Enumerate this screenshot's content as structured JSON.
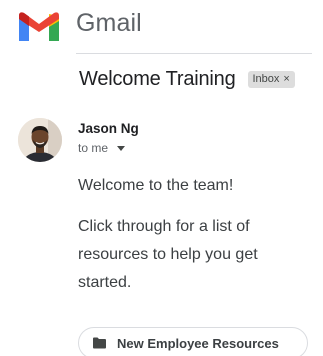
{
  "app": {
    "brand": "Gmail"
  },
  "message": {
    "subject": "Welcome Training",
    "label": {
      "name": "Inbox",
      "remove": "×"
    },
    "sender": {
      "name": "Jason Ng"
    },
    "recipient": "to me",
    "body": {
      "greeting": "Welcome to the team!",
      "paragraph": "Click through for a list of resources to help you get started."
    },
    "attachment": {
      "label": "New Employee Resources",
      "icon": "folder-icon"
    }
  },
  "colors": {
    "gmail_red": "#ea4335",
    "gmail_blue": "#4285f4",
    "gmail_green": "#34a853",
    "gmail_yellow": "#fbbc04",
    "dark_red": "#c5221f"
  }
}
